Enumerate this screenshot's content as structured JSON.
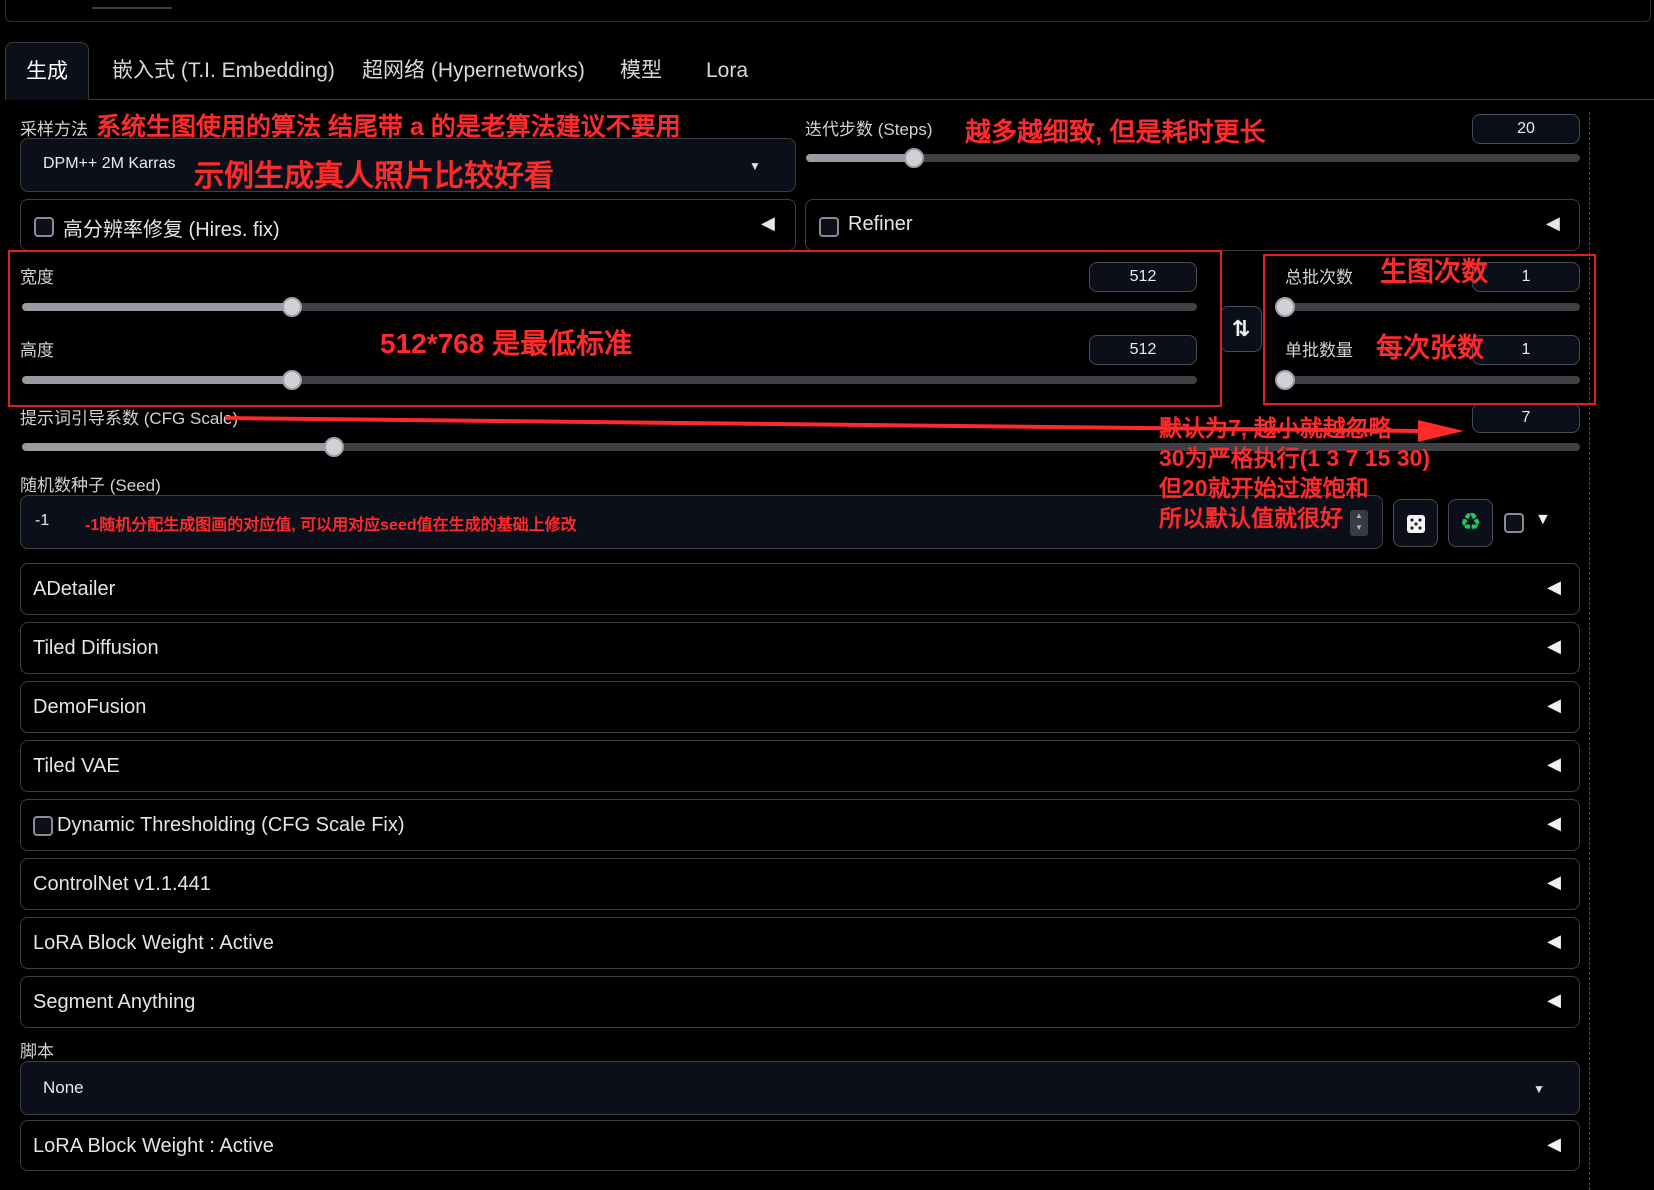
{
  "tabs": [
    "生成",
    "嵌入式 (T.I. Embedding)",
    "超网络 (Hypernetworks)",
    "模型",
    "Lora"
  ],
  "sampler": {
    "label": "采样方法",
    "value": "DPM++ 2M Karras"
  },
  "steps": {
    "label": "迭代步数 (Steps)",
    "value": "20",
    "fraction": 0.14
  },
  "hires": {
    "label": "高分辨率修复 (Hires. fix)",
    "checked": false
  },
  "refiner": {
    "label": "Refiner",
    "checked": false
  },
  "width": {
    "label": "宽度",
    "value": "512",
    "fraction": 0.23
  },
  "height": {
    "label": "高度",
    "value": "512",
    "fraction": 0.23
  },
  "swap_icon": "swap-vertical-icon",
  "batch_count": {
    "label": "总批次数",
    "value": "1",
    "fraction": 0.0
  },
  "batch_size": {
    "label": "单批数量",
    "value": "1",
    "fraction": 0.0
  },
  "cfg": {
    "label": "提示词引导系数 (CFG Scale)",
    "value": "7",
    "fraction": 0.2
  },
  "seed": {
    "label": "随机数种子 (Seed)",
    "value": "-1"
  },
  "seed_buttons": {
    "dice": "dice-icon",
    "recycle": "recycle-icon"
  },
  "accordions": [
    "ADetailer",
    "Tiled Diffusion",
    "DemoFusion",
    "Tiled VAE",
    "Dynamic Thresholding (CFG Scale Fix)",
    "ControlNet v1.1.441",
    "LoRA Block Weight : Active",
    "Segment Anything"
  ],
  "script": {
    "label": "脚本",
    "value": "None"
  },
  "last_accordion": "LoRA Block Weight : Active",
  "annotations": {
    "sampler_note": "系统生图使用的算法  结尾带 a 的是老算法建议不要用",
    "sampler_example": "示例生成真人照片比较好看",
    "steps_note": "越多越细致, 但是耗时更长",
    "batch_count_note": "生图次数",
    "batch_size_note": "每次张数",
    "size_note": "512*768 是最低标准",
    "cfg_note_1": "默认为7, 越小就越忽略",
    "cfg_note_2": "30为严格执行(1 3 7 15 30)",
    "cfg_note_3": "但20就开始过渡饱和",
    "cfg_note_4": "所以默认值就很好",
    "seed_note": "-1随机分配生成图画的对应值, 可以用对应seed值在生成的基础上修改"
  },
  "colors": {
    "annotation": "#ff2a2a",
    "input_bg": "#0b0f19",
    "border": "#3d3d43",
    "recycle": "#22c55e"
  }
}
